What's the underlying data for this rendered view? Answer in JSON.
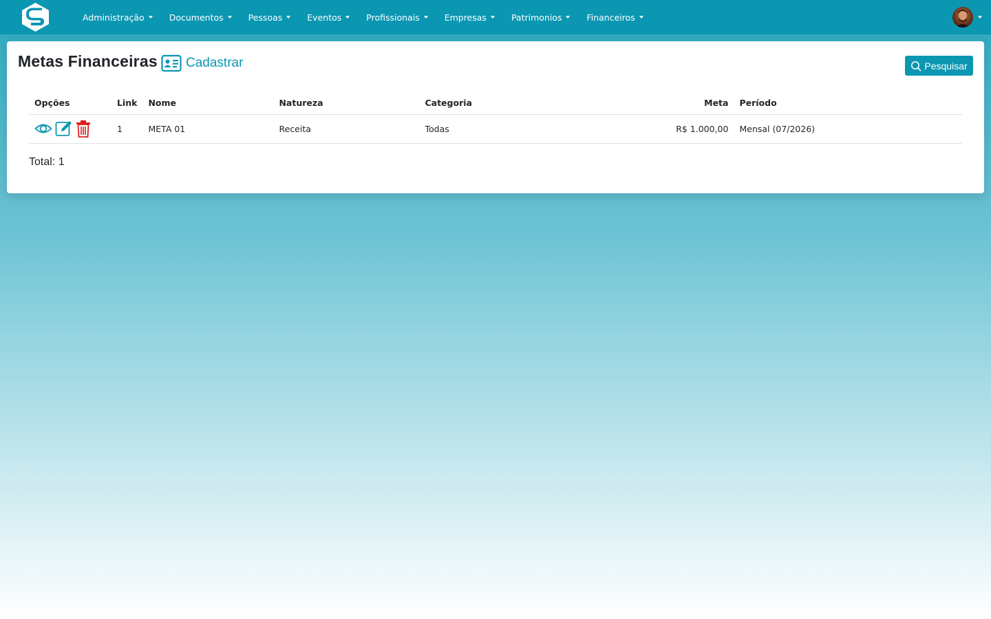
{
  "nav": {
    "items": [
      {
        "label": "Administração"
      },
      {
        "label": "Documentos"
      },
      {
        "label": "Pessoas"
      },
      {
        "label": "Eventos"
      },
      {
        "label": "Profissionais"
      },
      {
        "label": "Empresas"
      },
      {
        "label": "Patrimonios"
      },
      {
        "label": "Financeiros"
      }
    ],
    "logo_icon": "app-logo-s",
    "avatar_icon": "user-avatar"
  },
  "page": {
    "title": "Metas Financeiras",
    "register_label": "Cadastrar",
    "search_label": "Pesquisar"
  },
  "table": {
    "headers": {
      "options": "Opções",
      "link": "Link",
      "name": "Nome",
      "nature": "Natureza",
      "category": "Categoria",
      "goal": "Meta",
      "period": "Período"
    },
    "rows": [
      {
        "link": "1",
        "name": "META 01",
        "nature": "Receita",
        "category": "Todas",
        "goal": "R$ 1.000,00",
        "period": "Mensal (07/2026)"
      }
    ]
  },
  "footer": {
    "total": "Total: 1"
  },
  "colors": {
    "primary": "#0b97b2",
    "danger": "#dc1e1e"
  }
}
